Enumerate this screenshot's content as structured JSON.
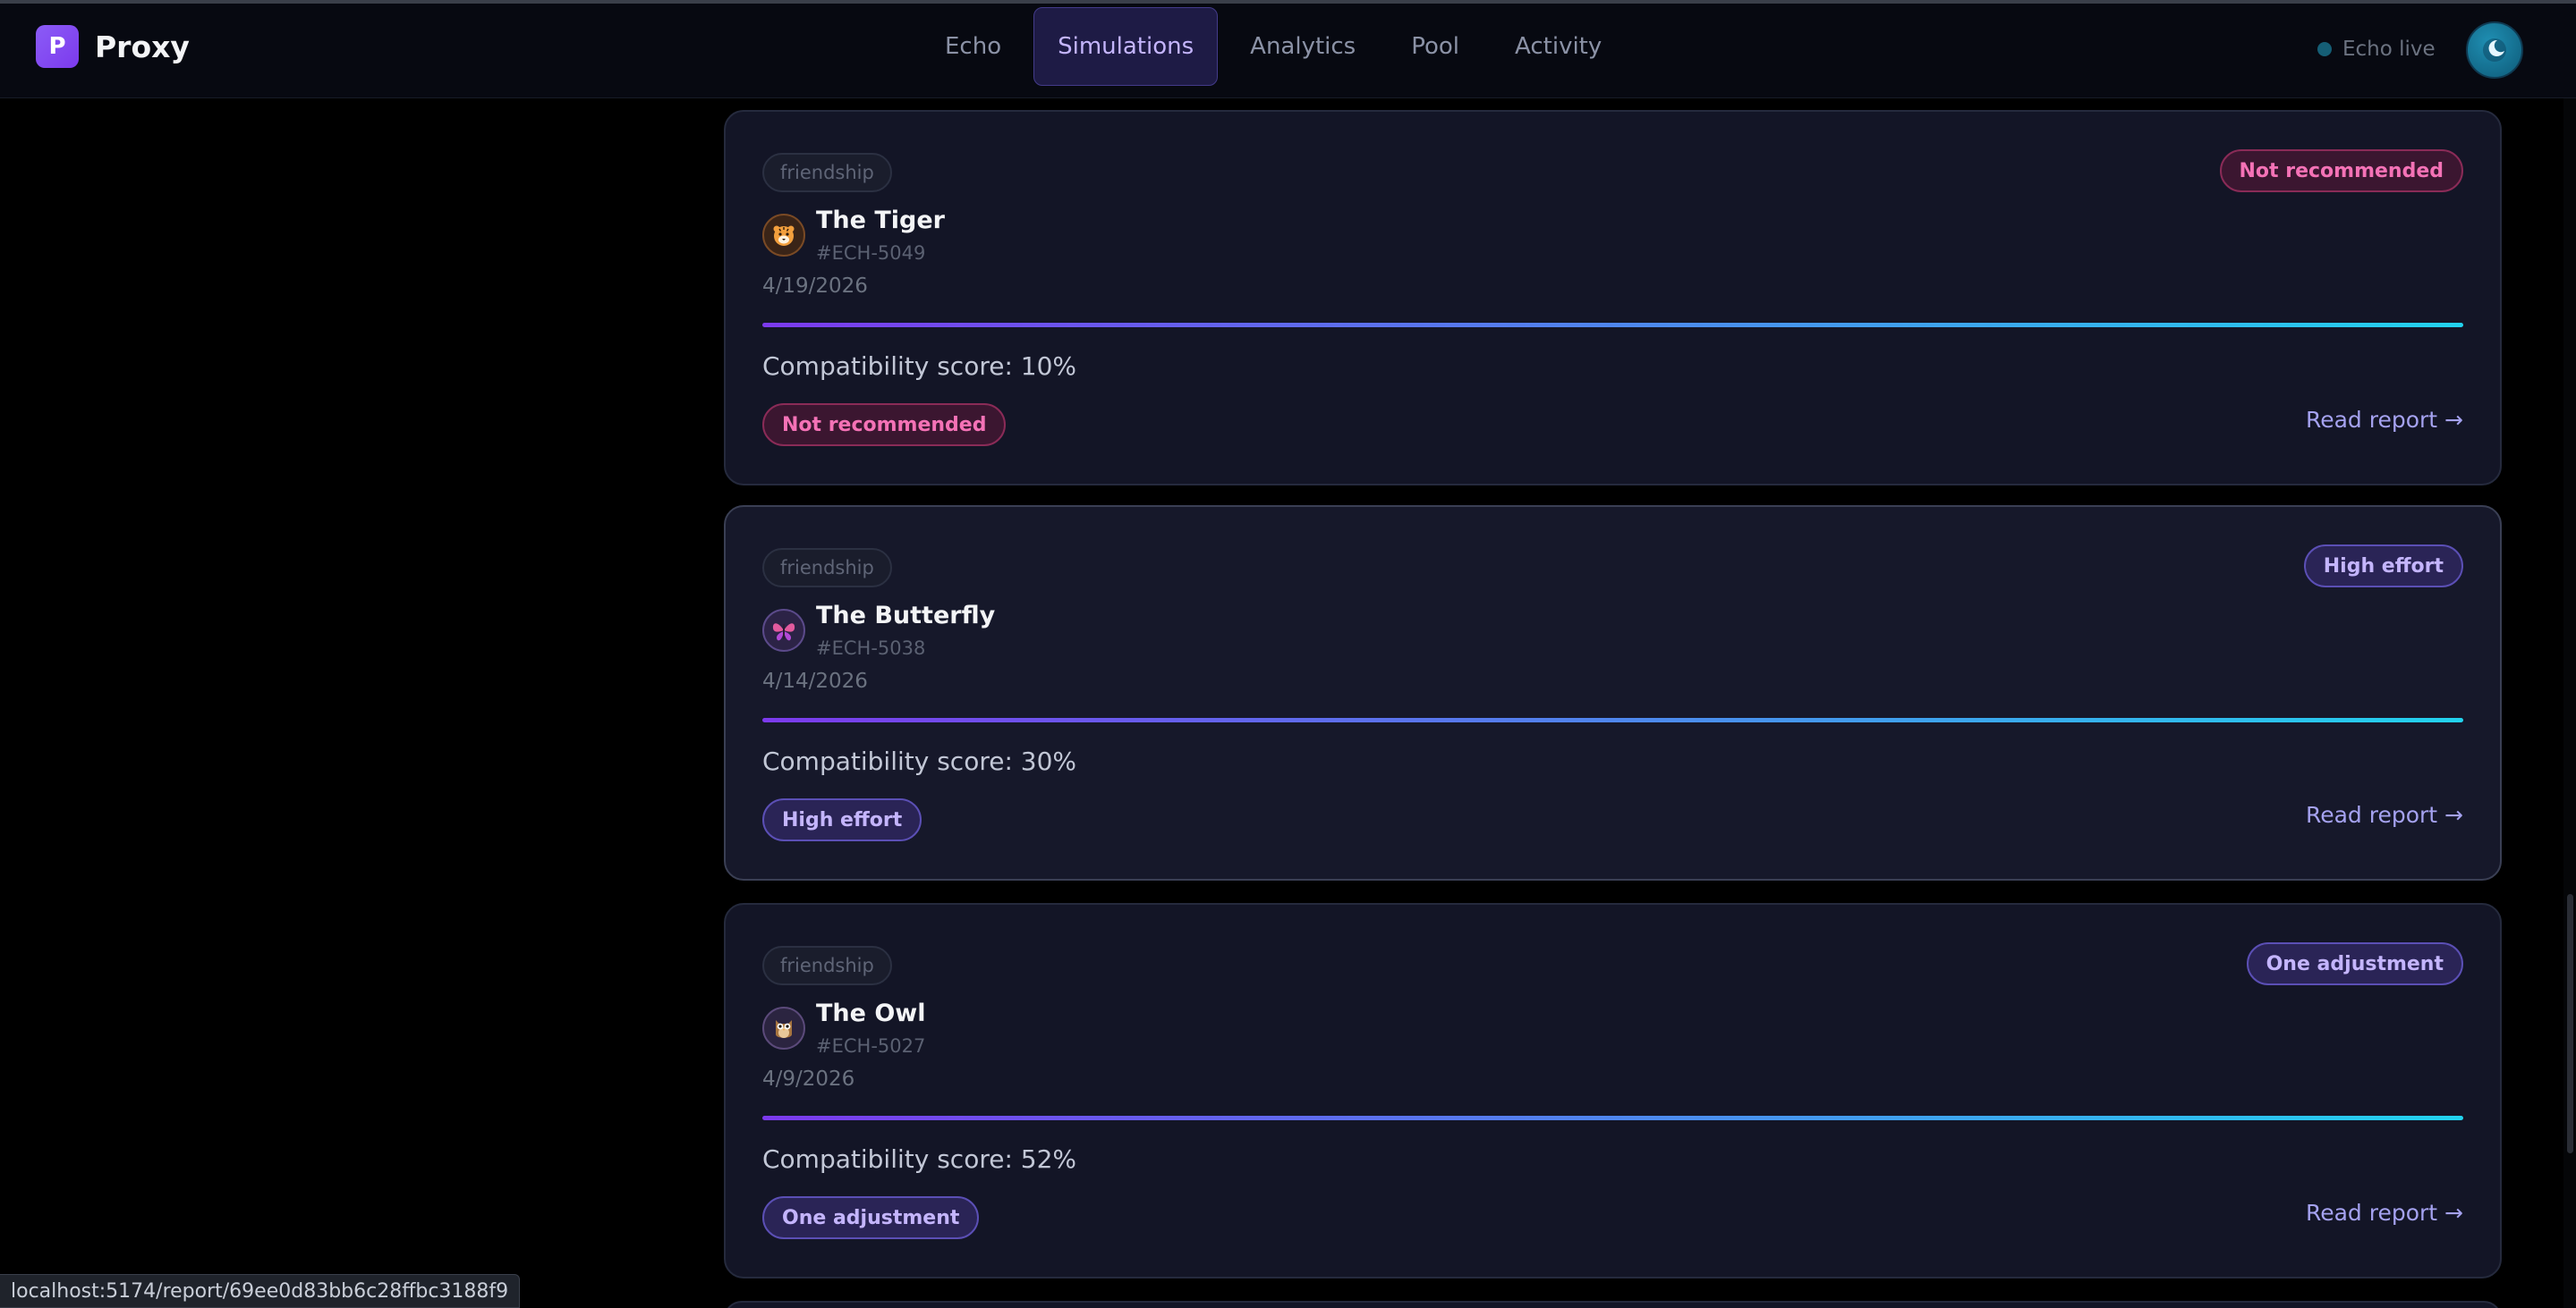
{
  "brand": {
    "initial": "P",
    "name": "Proxy"
  },
  "nav": {
    "items": [
      {
        "label": "Echo",
        "active": false
      },
      {
        "label": "Simulations",
        "active": true
      },
      {
        "label": "Analytics",
        "active": false
      },
      {
        "label": "Pool",
        "active": false
      },
      {
        "label": "Activity",
        "active": false
      }
    ]
  },
  "status": {
    "label": "Echo live"
  },
  "cards": [
    {
      "tag": "friendship",
      "icon": "tiger-icon",
      "name": "The Tiger",
      "code": "#ECH-5049",
      "date": "4/19/2026",
      "score_text": "Compatibility score: 10%",
      "score": 10,
      "badge_top": "Not recommended",
      "badge_bottom": "Not recommended",
      "badge_color": "#f472b6",
      "link": "Read report →"
    },
    {
      "tag": "friendship",
      "icon": "butterfly-icon",
      "name": "The Butterfly",
      "code": "#ECH-5038",
      "date": "4/14/2026",
      "score_text": "Compatibility score: 30%",
      "score": 30,
      "badge_top": "High effort",
      "badge_bottom": "High effort",
      "badge_color": "#c4b5fd",
      "link": "Read report →"
    },
    {
      "tag": "friendship",
      "icon": "owl-icon",
      "name": "The Owl",
      "code": "#ECH-5027",
      "date": "4/9/2026",
      "score_text": "Compatibility score: 52%",
      "score": 52,
      "badge_top": "One adjustment",
      "badge_bottom": "One adjustment",
      "badge_color": "#c4b5fd",
      "link": "Read report →"
    }
  ],
  "url_status": "localhost:5174/report/69ee0d83bb6c28ffbc3188f9"
}
